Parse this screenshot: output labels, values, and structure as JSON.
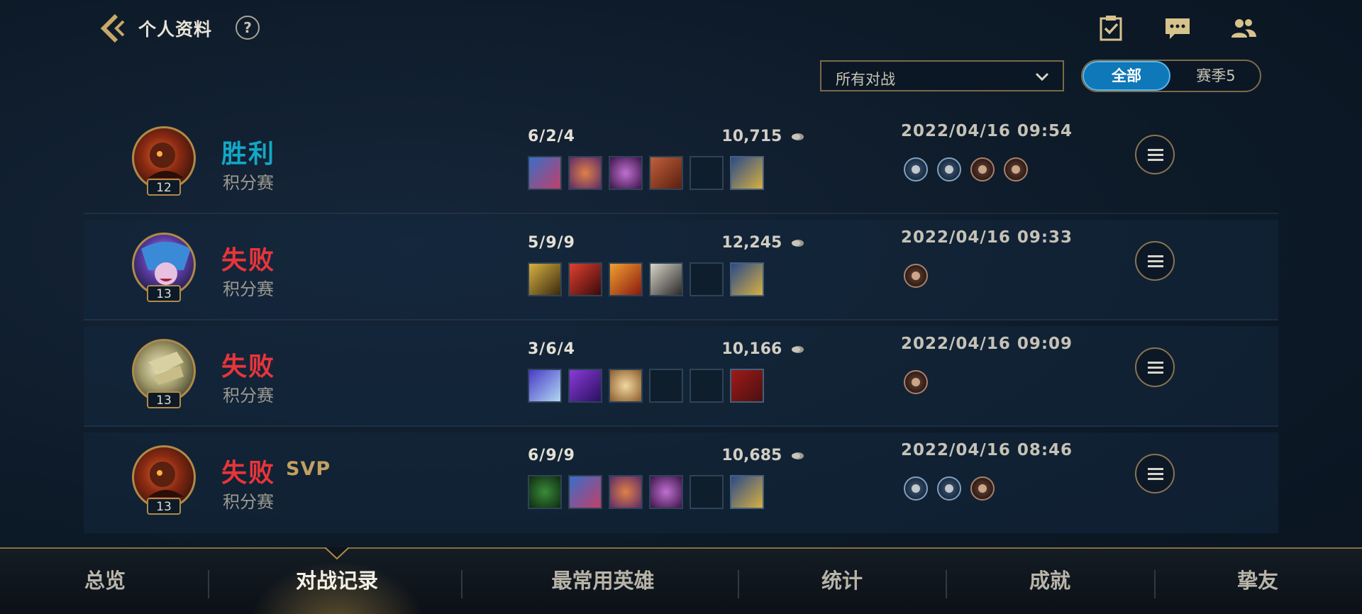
{
  "header": {
    "title": "个人资料",
    "help_label": "?",
    "icons": [
      "back-chevron-icon",
      "clipboard-check-icon",
      "chat-icon",
      "friends-icon"
    ]
  },
  "filters": {
    "select_value": "所有对战",
    "segments": [
      "全部",
      "赛季5"
    ],
    "selected_segment": "全部"
  },
  "matches": [
    {
      "level": "12",
      "result": "胜利",
      "outcome": "win",
      "svp": "",
      "mode": "积分赛",
      "kda": "6/2/4",
      "gold": "10,715",
      "date": "2022/04/16 09:54",
      "medals": [
        "blue",
        "blue",
        "bronze",
        "bronze"
      ],
      "items": 5,
      "trinket": "yellow"
    },
    {
      "level": "13",
      "result": "失败",
      "outcome": "loss",
      "svp": "",
      "mode": "积分赛",
      "kda": "5/9/9",
      "gold": "12,245",
      "date": "2022/04/16 09:33",
      "medals": [
        "bronze"
      ],
      "items": 4,
      "trinket": "yellow"
    },
    {
      "level": "13",
      "result": "失败",
      "outcome": "loss",
      "svp": "",
      "mode": "积分赛",
      "kda": "3/6/4",
      "gold": "10,166",
      "date": "2022/04/16 09:09",
      "medals": [
        "bronze"
      ],
      "items": 3,
      "trinket": "red"
    },
    {
      "level": "13",
      "result": "失败",
      "outcome": "loss",
      "svp": "SVP",
      "mode": "积分赛",
      "kda": "6/9/9",
      "gold": "10,685",
      "date": "2022/04/16 08:46",
      "medals": [
        "blue",
        "blue",
        "bronze"
      ],
      "items": 4,
      "trinket": "yellow"
    }
  ],
  "nav": {
    "items": [
      "总览",
      "对战记录",
      "最常用英雄",
      "统计",
      "成就",
      "挚友"
    ],
    "active": "对战记录"
  },
  "colors": {
    "win": "#12a7c5",
    "loss": "#e8353a",
    "svp": "#c2a062",
    "accent_gold": "#b08a48",
    "segment_active": "#0e78b8"
  }
}
